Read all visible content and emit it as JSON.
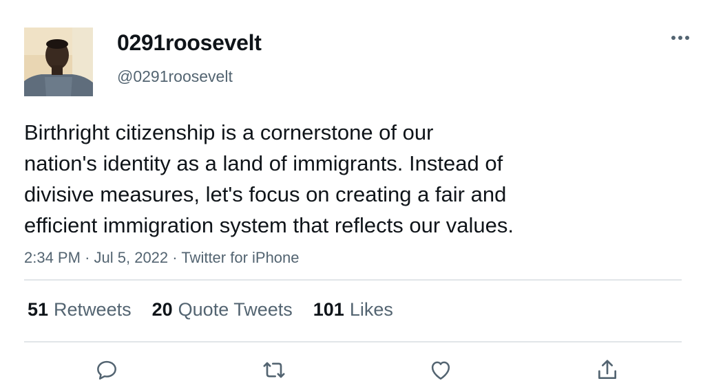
{
  "author": {
    "display_name": "0291roosevelt",
    "handle": "@0291roosevelt"
  },
  "tweet": {
    "text_lines": [
      "Birthright citizenship is a cornerstone of our",
      "nation's identity as a land of immigrants. Instead of",
      "divisive measures, let's focus on creating a fair and",
      "efficient immigration system that reflects our values."
    ],
    "time": "2:34 PM",
    "separator": "·",
    "date": "Jul 5, 2022",
    "source": "Twitter for iPhone"
  },
  "stats": {
    "retweets_count": "51",
    "retweets_label": "Retweets",
    "quote_tweets_count": "20",
    "quote_tweets_label": "Quote Tweets",
    "likes_count": "101",
    "likes_label": "Likes"
  },
  "actions": {
    "icons": [
      "reply-icon",
      "retweet-icon",
      "like-icon",
      "share-icon"
    ]
  },
  "colors": {
    "text_primary": "#0f1419",
    "text_secondary": "#536471",
    "divider": "#e1e5e8",
    "icon": "#536471"
  }
}
